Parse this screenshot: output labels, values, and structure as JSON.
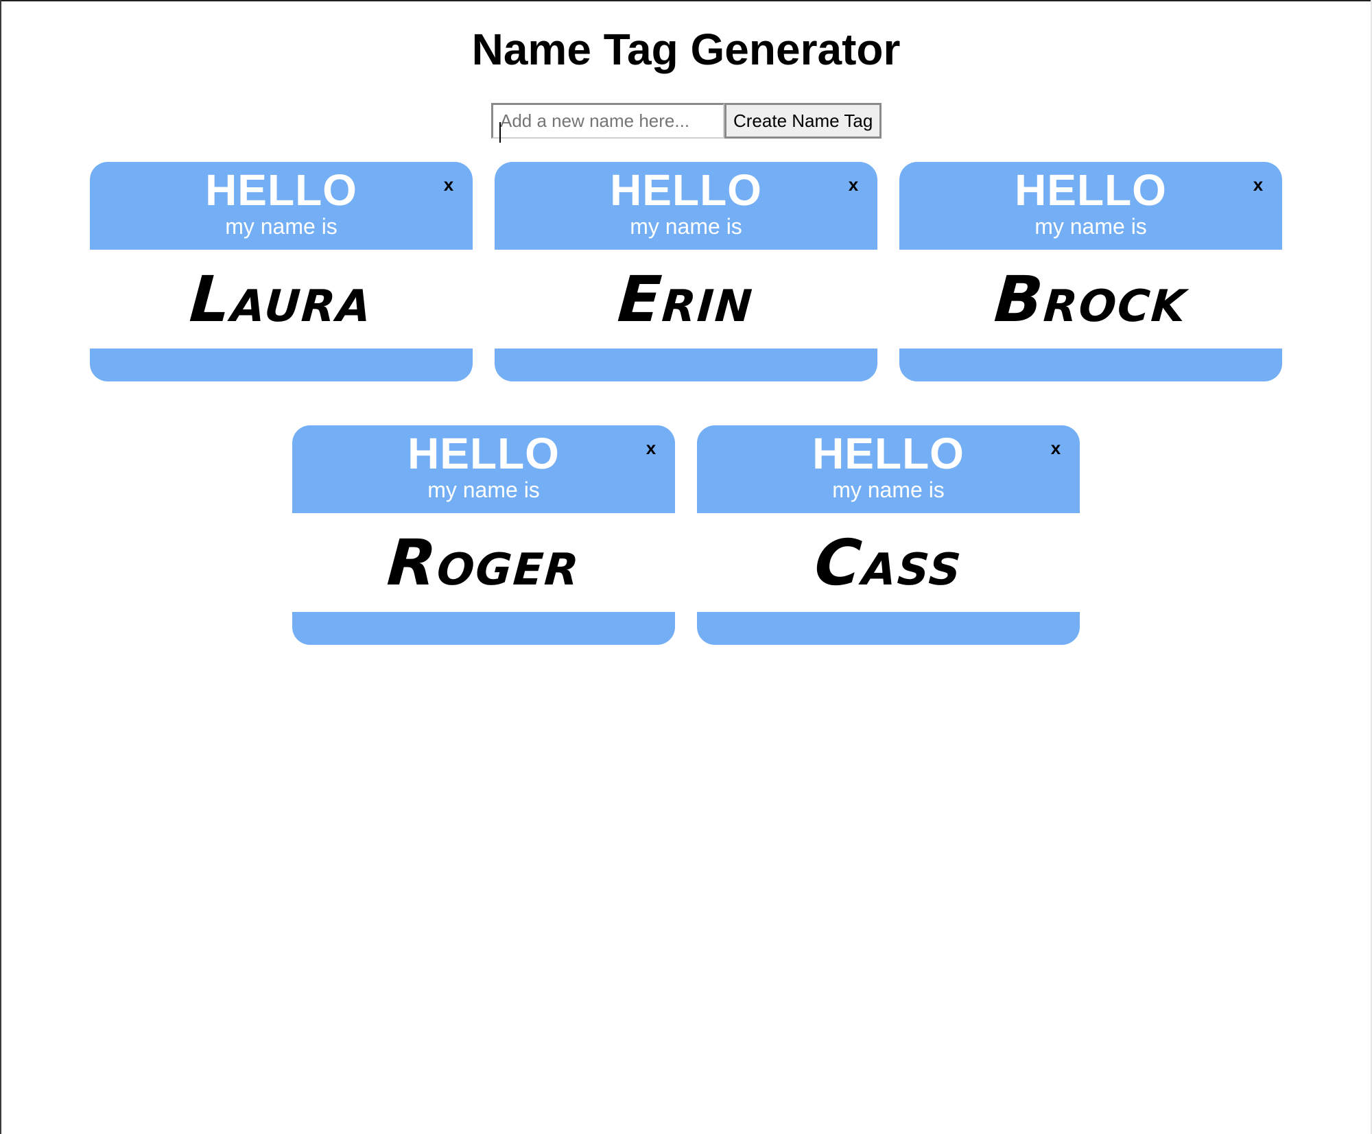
{
  "header": {
    "title": "Name Tag Generator"
  },
  "form": {
    "input_value": "",
    "input_placeholder": "Add a new name here...",
    "create_button_label": "Create Name Tag"
  },
  "tag_template": {
    "hello": "HELLO",
    "subtitle": "my name is",
    "remove_label": "x"
  },
  "tags": [
    {
      "name": "Laura"
    },
    {
      "name": "Erin"
    },
    {
      "name": "Brock"
    },
    {
      "name": "Roger"
    },
    {
      "name": "Cass"
    }
  ],
  "colors": {
    "tag_accent": "#74aff6",
    "tag_body": "#ffffff",
    "text": "#000000"
  }
}
